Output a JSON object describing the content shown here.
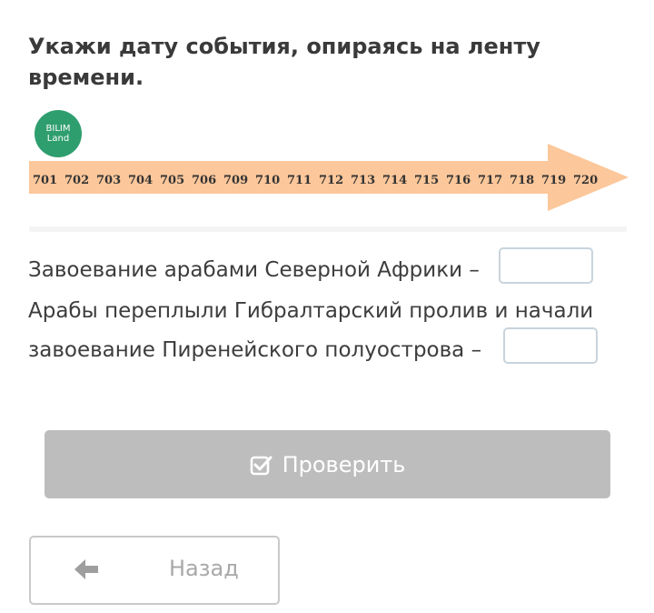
{
  "title": "Укажи дату события, опираясь на ленту времени.",
  "logo": {
    "line1": "BILIM",
    "line2": "Land",
    "color": "#2f9e6e"
  },
  "timeline": {
    "arrow_color": "#fcc79a",
    "years": [
      "701",
      "702",
      "703",
      "704",
      "705",
      "706",
      "709",
      "710",
      "711",
      "712",
      "713",
      "714",
      "715",
      "716",
      "717",
      "718",
      "719",
      "720"
    ]
  },
  "questions": {
    "q1": "Завоевание арабами Северной Африки –",
    "q2_line1": "Арабы переплыли Гибралтарский пролив и начали",
    "q2_line2": "завоевание Пиренейского полуострова –",
    "answer1": "",
    "answer2": ""
  },
  "check_button": {
    "label": "Проверить",
    "icon": "checkbox-icon",
    "color": "#bdbdbd"
  },
  "back_button": {
    "label": "Назад",
    "icon": "arrow-left-icon"
  }
}
